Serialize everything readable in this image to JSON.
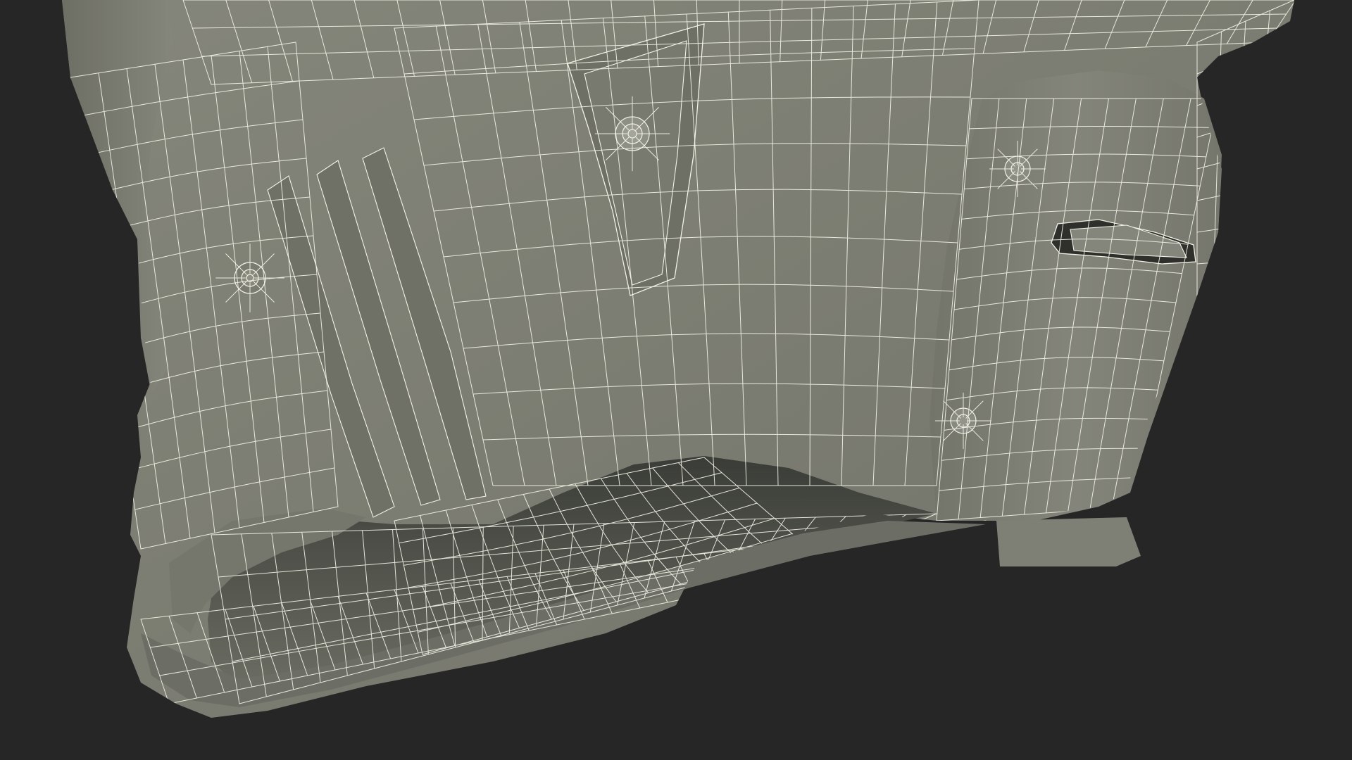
{
  "scene": {
    "subject": "wireframe-3d-armor-model",
    "colors": {
      "background": "#262626",
      "surface": "#7b7c71",
      "surface_light": "#8a8b80",
      "surface_dark": "#5e5f56",
      "interior": "#4f514a",
      "interior_deep": "#3c3e39",
      "wire": "#f2f2e6"
    }
  }
}
